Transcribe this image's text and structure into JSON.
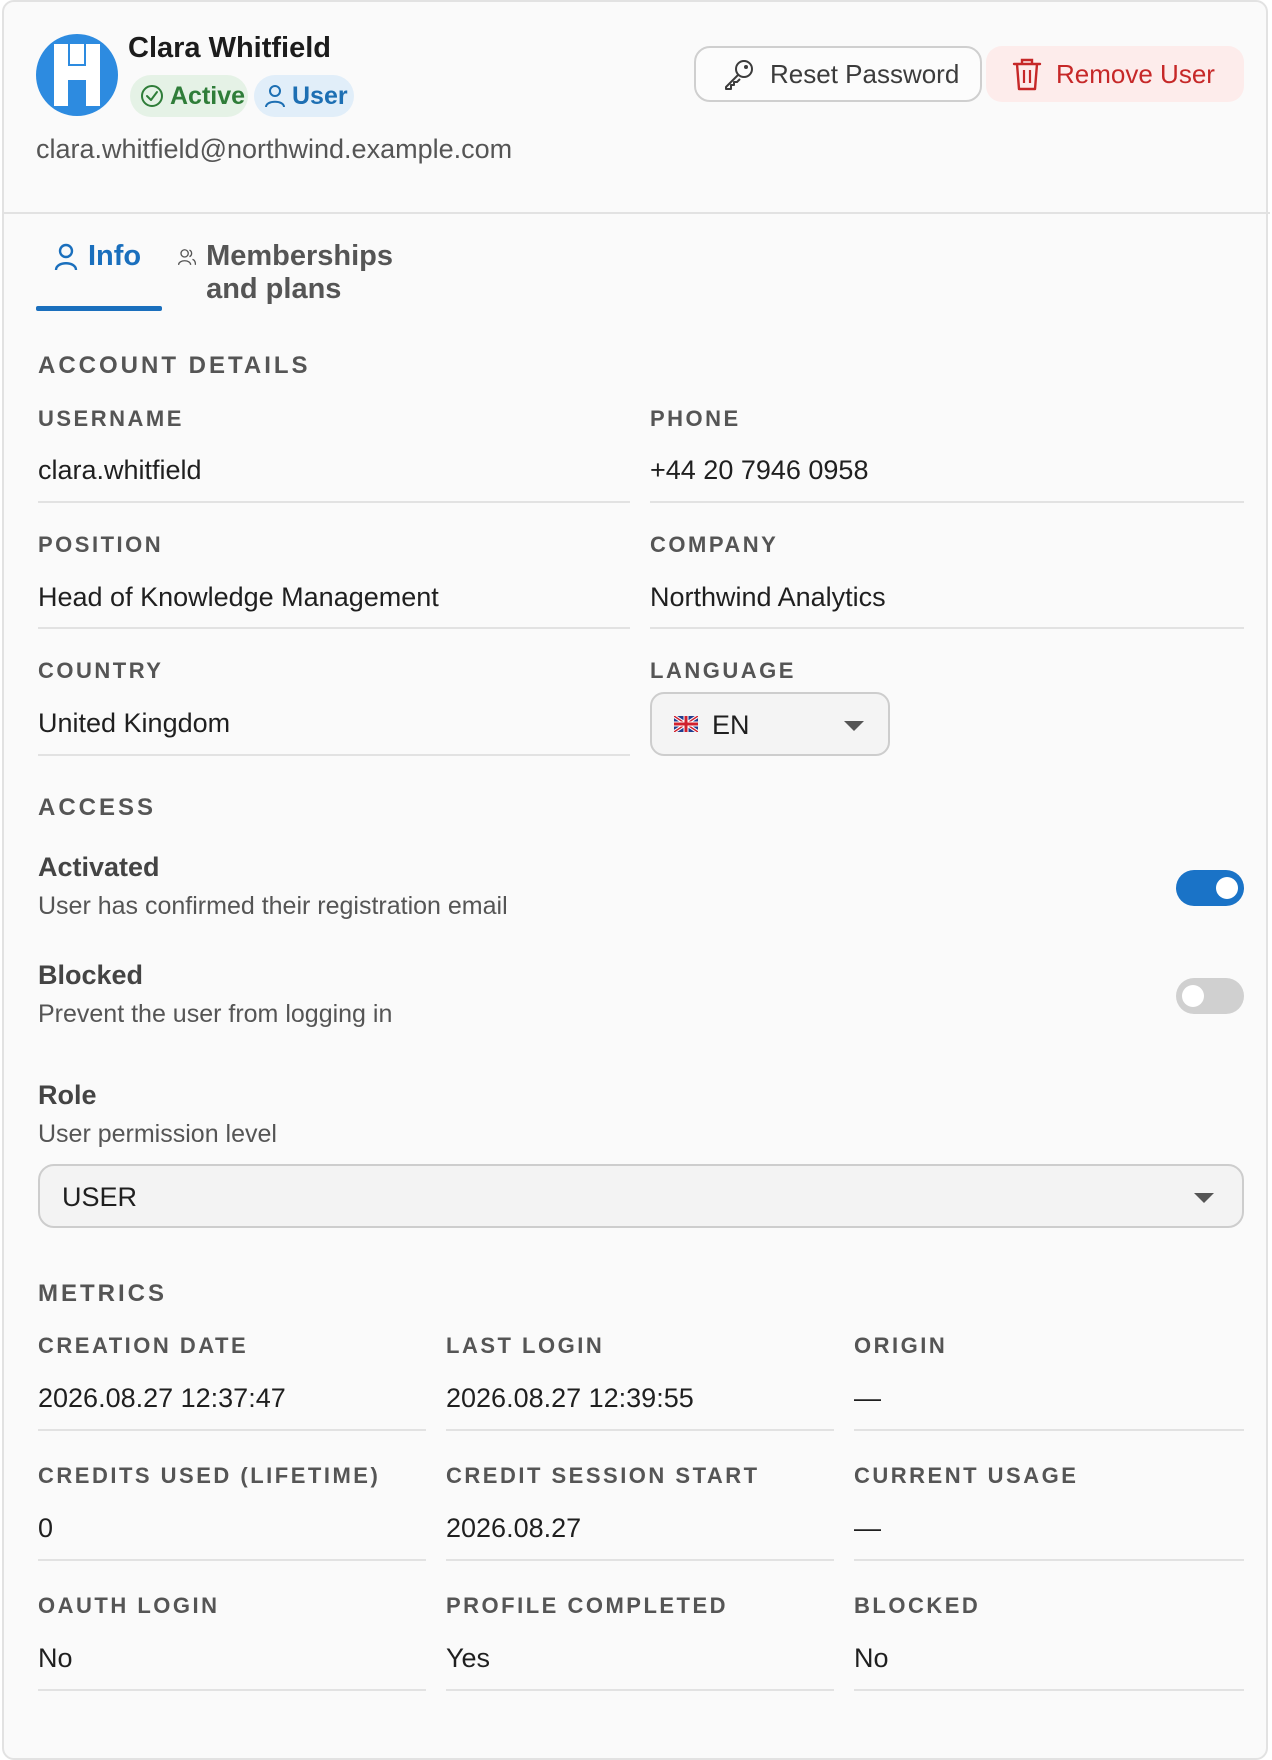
{
  "user": {
    "name": "Clara Whitfield",
    "email": "clara.whitfield@northwind.example.com",
    "status_badge": "Active",
    "role_badge": "User"
  },
  "actions": {
    "reset_password": "Reset Password",
    "remove_user": "Remove User"
  },
  "tabs": [
    {
      "label": "Info",
      "active": true
    },
    {
      "label": "Memberships and plans",
      "active": false
    }
  ],
  "account": {
    "title": "ACCOUNT DETAILS",
    "username_label": "USERNAME",
    "username": "clara.whitfield",
    "phone_label": "PHONE",
    "phone": "+44 20 7946 0958",
    "position_label": "POSITION",
    "position": "Head of Knowledge Management",
    "company_label": "COMPANY",
    "company": "Northwind Analytics",
    "country_label": "COUNTRY",
    "country": "United Kingdom",
    "language_label": "LANGUAGE",
    "language": "EN"
  },
  "access": {
    "title": "ACCESS",
    "activated_title": "Activated",
    "activated_desc": "User has confirmed their registration email",
    "activated_on": true,
    "blocked_title": "Blocked",
    "blocked_desc": "Prevent the user from logging in",
    "blocked_on": false,
    "role_title": "Role",
    "role_desc": "User permission level",
    "role_value": "USER"
  },
  "metrics": {
    "title": "METRICS",
    "creation_date_label": "CREATION DATE",
    "creation_date": "2026.08.27 12:37:47",
    "last_login_label": "LAST LOGIN",
    "last_login": "2026.08.27 12:39:55",
    "origin_label": "ORIGIN",
    "origin": "—",
    "credits_used_label": "CREDITS USED (LIFETIME)",
    "credits_used": "0",
    "credit_session_label": "CREDIT SESSION START",
    "credit_session": "2026.08.27",
    "current_usage_label": "CURRENT USAGE",
    "current_usage": "—",
    "oauth_label": "OAUTH LOGIN",
    "oauth": "No",
    "profile_completed_label": "PROFILE COMPLETED",
    "profile_completed": "Yes",
    "blocked_label": "BLOCKED",
    "blocked": "No"
  },
  "colors": {
    "accent": "#1a6fbd",
    "danger": "#c62828",
    "success": "#2f7d39"
  }
}
